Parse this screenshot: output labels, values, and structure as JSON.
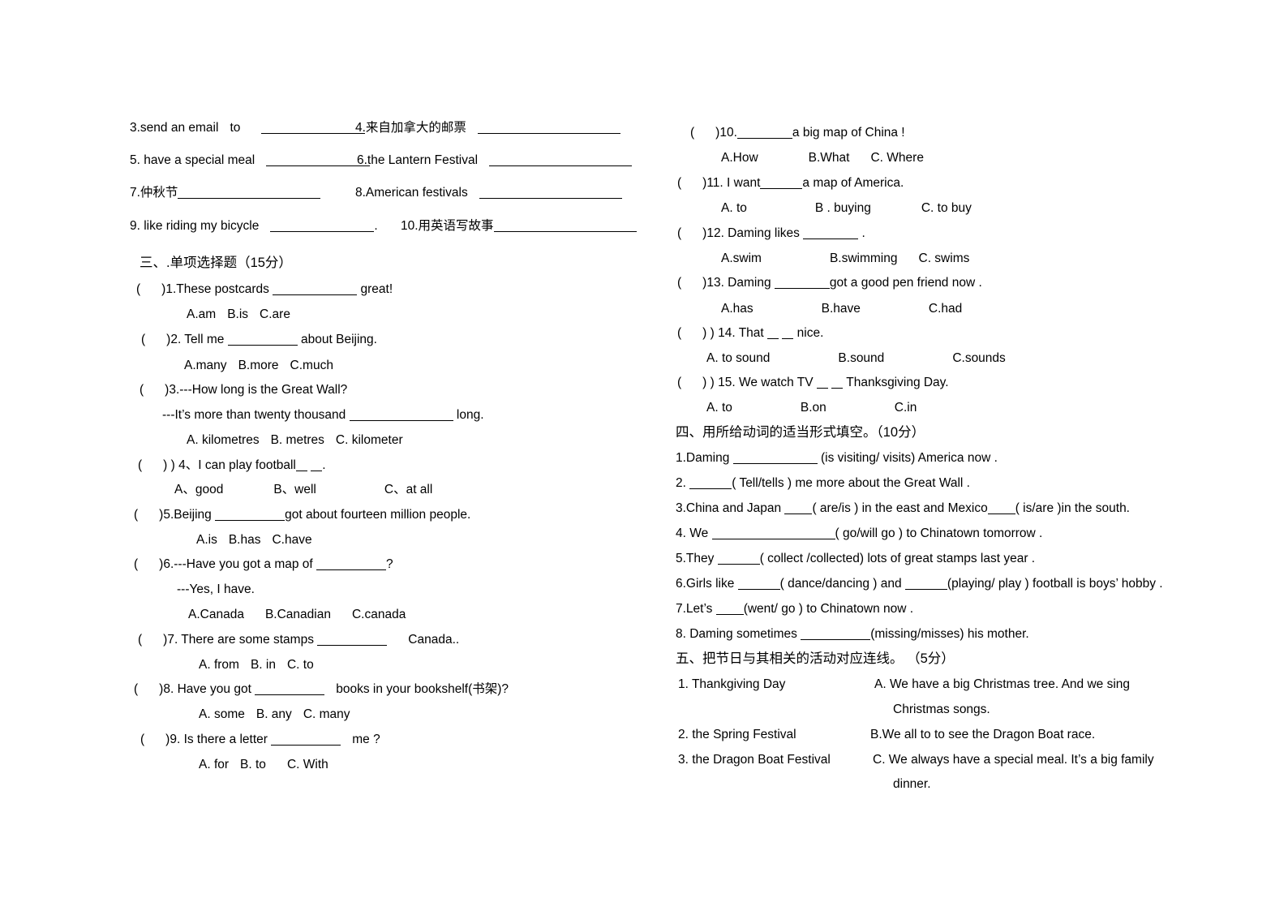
{
  "document": {
    "type": "english-exam-worksheet",
    "background": "#ffffff",
    "text_color": "#000000"
  },
  "translation_section": {
    "items": [
      {
        "num": "3.",
        "text": "send an email",
        "text2": "to",
        "blank": "bl-xxl"
      },
      {
        "num": "4.",
        "text": "来自加拿大的邮票",
        "blank": "bl-ww"
      },
      {
        "num": "5.",
        "text": "have a special meal",
        "blank": "bl-xxl"
      },
      {
        "num": "6.",
        "text": "the Lantern Festival",
        "blank": "bl-ww"
      },
      {
        "num": "7.",
        "text": "仲秋节",
        "blank": "bl-ww"
      },
      {
        "num": "8.",
        "text": "American festivals",
        "blank": "bl-ww"
      },
      {
        "num": "9.",
        "text": "like riding my bicycle",
        "blank": "bl-xxl"
      },
      {
        "num": "10.",
        "text": "用英语写故事",
        "blank": "bl-ww"
      }
    ],
    "l1_a": "3.send an email",
    "l1_a2": "to",
    "l1_b": "4.来自加拿大的邮票",
    "l2_a": "5. have a special meal",
    "l2_b": "6.the Lantern Festival",
    "l3_a": "7.仲秋节",
    "l3_b": "8.American festivals",
    "l4_a": "9. like riding my bicycle",
    "l4_sep": ".",
    "l4_b": "10.用英语写故事"
  },
  "section3": {
    "heading": "三、.单项选择题（15分）",
    "questions": [
      {
        "id": 1,
        "stem_pre": ")1.These postcards",
        "stem_post": "great!",
        "options": [
          "A.am",
          "B.is",
          "C.are"
        ]
      },
      {
        "id": 2,
        "stem_pre": ")2. Tell me",
        "stem_post": "about Beijing.",
        "options": [
          "A.many",
          "B.more",
          "C.much"
        ]
      },
      {
        "id": 3,
        "stem_pre": ")3.---How long is the Great Wall?",
        "stem_line2_pre": "---It’s more than twenty thousand",
        "stem_line2_post": "long.",
        "options": [
          "A. kilometres",
          "B. metres",
          "C. kilometer"
        ]
      },
      {
        "id": 4,
        "stem_pre": ") 4、I can play football",
        "stem_post": ".",
        "options": [
          "A、good",
          "B、well",
          "C、at all"
        ]
      },
      {
        "id": 5,
        "stem_pre": ")5.Beijing",
        "stem_post": "got about fourteen million people.",
        "options": [
          "A.is",
          "B.has",
          "C.have"
        ]
      },
      {
        "id": 6,
        "stem_pre": ")6.---Have you got a map of",
        "stem_post": "?",
        "stem_line2": "---Yes, I have.",
        "options": [
          "A.Canada",
          "B.Canadian",
          "C.canada"
        ]
      },
      {
        "id": 7,
        "stem_pre": ")7. There are some stamps",
        "stem_post": "Canada..",
        "options": [
          "A. from",
          "B. in",
          "C. to"
        ]
      },
      {
        "id": 8,
        "stem_pre": ")8. Have you got",
        "stem_post": "books in your bookshelf(书架)?",
        "options": [
          "A. some",
          "B. any",
          "C. many"
        ]
      },
      {
        "id": 9,
        "stem_pre": ")9. Is there a letter",
        "stem_post": "me ?",
        "options": [
          "A. for",
          "B. to",
          "C. With"
        ]
      },
      {
        "id": 10,
        "stem_pre": ")10.",
        "stem_post": "a   big   map   of   China !",
        "options": [
          "A.How",
          "B.What",
          "C. Where"
        ]
      },
      {
        "id": 11,
        "stem_pre": ")11. I   want",
        "stem_post": "a   map   of   America.",
        "options": [
          "A. to",
          "B . buying",
          "C. to buy"
        ]
      },
      {
        "id": 12,
        "stem_pre": ")12. Daming   likes",
        "stem_post": ".",
        "options": [
          "A.swim",
          "B.swimming",
          "C.   swims"
        ]
      },
      {
        "id": 13,
        "stem_pre": ")13. Daming",
        "stem_post": "got   a   good   pen   friend   now .",
        "options": [
          "A.has",
          "B.have",
          "C.had"
        ]
      },
      {
        "id": 14,
        "stem_pre": ") 14. That",
        "stem_post": "nice.",
        "options": [
          "A. to sound",
          "B.sound",
          "C.sounds"
        ]
      },
      {
        "id": 15,
        "stem_pre": ") 15. We watch   TV",
        "stem_post": "Thanksgiving   Day.",
        "options": [
          "A.   to",
          "B.on",
          "C.in"
        ]
      }
    ]
  },
  "section4": {
    "heading": "四、用所给动词的适当形式填空。（10分）",
    "items": [
      {
        "pre": "1.Daming",
        "post": "(is visiting/ visits) America now ."
      },
      {
        "pre": "2.",
        "post": "( Tell/tells ) me more about the Great Wall ."
      },
      {
        "pre": "3.China and Japan",
        "mid": "( are/is ) in the east and Mexico",
        "post": "( is/are )in the south."
      },
      {
        "pre": "4. We",
        "post": "( go/will go ) to Chinatown tomorrow ."
      },
      {
        "pre": "5.They",
        "post": "( collect /collected) lots of great stamps last year ."
      },
      {
        "pre": "6.Girls like",
        "mid": "( dance/dancing ) and",
        "post": "(playing/ play ) football is boys’ hobby ."
      },
      {
        "pre": "7.Let’s",
        "post": "(went/ go ) to Chinatown now ."
      },
      {
        "pre": "8. Daming sometimes",
        "post": "(missing/misses) his mother."
      }
    ]
  },
  "section5": {
    "heading": "五、把节日与其相关的活动对应连线。 （5分）",
    "left": [
      "1. Thankgiving  Day",
      "2. the   Spring   Festival",
      "3. the Dragon Boat Festival"
    ],
    "right": [
      "A.  We  have  a  big  Christmas  tree.  And  we  sing",
      "Christmas songs.",
      "B.We all to to see the Dragon Boat race.",
      "C. We always have a special meal. It’s a big family",
      "dinner."
    ]
  }
}
